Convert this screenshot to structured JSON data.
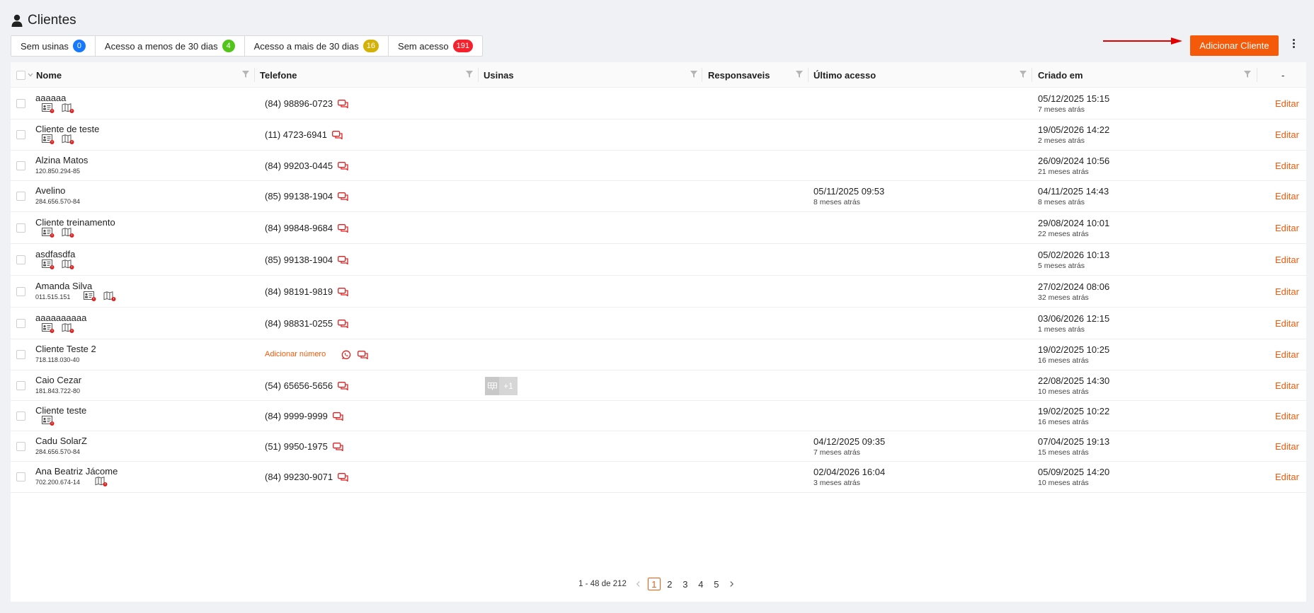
{
  "page": {
    "title": "Clientes"
  },
  "filters": [
    {
      "label": "Sem usinas",
      "count": "0",
      "color": "#1677ff"
    },
    {
      "label": "Acesso a menos de 30 dias",
      "count": "4",
      "color": "#52c41a"
    },
    {
      "label": "Acesso a mais de 30 dias",
      "count": "16",
      "color": "#d4b106"
    },
    {
      "label": "Sem acesso",
      "count": "191",
      "color": "#f5222d"
    }
  ],
  "toolbar": {
    "add_label": "Adicionar Cliente"
  },
  "table": {
    "headers": {
      "name": "Nome",
      "phone": "Telefone",
      "usinas": "Usinas",
      "responsaveis": "Responsaveis",
      "last_access": "Último acesso",
      "created": "Criado em",
      "actions": "-"
    },
    "edit_label": "Editar",
    "rows": [
      {
        "name": "aaaaaa",
        "doc": "",
        "icons": [
          "id",
          "map"
        ],
        "phone": "(84) 98896-0723",
        "last_access": "",
        "last_access_ago": "",
        "created": "05/12/2025 15:15",
        "created_ago": "7 meses atrás"
      },
      {
        "name": "Cliente de teste",
        "doc": "",
        "icons": [
          "id",
          "map"
        ],
        "phone": "(11) 4723-6941",
        "last_access": "",
        "last_access_ago": "",
        "created": "19/05/2026 14:22",
        "created_ago": "2 meses atrás"
      },
      {
        "name": "Alzina Matos",
        "doc": "120.850.294-85",
        "icons": [],
        "phone": "(84) 99203-0445",
        "last_access": "",
        "last_access_ago": "",
        "created": "26/09/2024 10:56",
        "created_ago": "21 meses atrás"
      },
      {
        "name": "Avelino",
        "doc": "284.656.570-84",
        "icons": [],
        "phone": "(85) 99138-1904",
        "last_access": "05/11/2025 09:53",
        "last_access_ago": "8 meses atrás",
        "created": "04/11/2025 14:43",
        "created_ago": "8 meses atrás"
      },
      {
        "name": "Cliente treinamento",
        "doc": "",
        "icons": [
          "id",
          "map"
        ],
        "phone": "(84) 99848-9684",
        "last_access": "",
        "last_access_ago": "",
        "created": "29/08/2024 10:01",
        "created_ago": "22 meses atrás"
      },
      {
        "name": "asdfasdfa",
        "doc": "",
        "icons": [
          "id",
          "map"
        ],
        "phone": "(85) 99138-1904",
        "last_access": "",
        "last_access_ago": "",
        "created": "05/02/2026 10:13",
        "created_ago": "5 meses atrás"
      },
      {
        "name": "Amanda Silva",
        "doc": "011.515.151",
        "icons": [
          "id",
          "map"
        ],
        "phone": "(84) 98191-9819",
        "last_access": "",
        "last_access_ago": "",
        "created": "27/02/2024 08:06",
        "created_ago": "32 meses atrás"
      },
      {
        "name": "aaaaaaaaaa",
        "doc": "",
        "icons": [
          "id",
          "map"
        ],
        "phone": "(84) 98831-0255",
        "last_access": "",
        "last_access_ago": "",
        "created": "03/06/2026 12:15",
        "created_ago": "1 meses atrás"
      },
      {
        "name": "Cliente Teste 2",
        "doc": "718.118.030-40",
        "icons": [],
        "phone": "",
        "add_number": "Adicionar número",
        "last_access": "",
        "last_access_ago": "",
        "created": "19/02/2025 10:25",
        "created_ago": "16 meses atrás"
      },
      {
        "name": "Caio Cezar",
        "doc": "181.843.722-80",
        "icons": [],
        "phone": "(54) 65656-5656",
        "usina_more": "+1",
        "last_access": "",
        "last_access_ago": "",
        "created": "22/08/2025 14:30",
        "created_ago": "10 meses atrás"
      },
      {
        "name": "Cliente teste",
        "doc": "",
        "icons": [
          "id"
        ],
        "phone": "(84) 9999-9999",
        "last_access": "",
        "last_access_ago": "",
        "created": "19/02/2025 10:22",
        "created_ago": "16 meses atrás"
      },
      {
        "name": "Cadu SolarZ",
        "doc": "284.656.570-84",
        "icons": [],
        "phone": "(51) 9950-1975",
        "last_access": "04/12/2025 09:35",
        "last_access_ago": "7 meses atrás",
        "created": "07/04/2025 19:13",
        "created_ago": "15 meses atrás"
      },
      {
        "name": "Ana Beatriz Jácome",
        "doc": "702.200.674-14",
        "icons": [
          "map"
        ],
        "phone": "(84) 99230-9071",
        "last_access": "02/04/2026 16:04",
        "last_access_ago": "3 meses atrás",
        "created": "05/09/2025 14:20",
        "created_ago": "10 meses atrás"
      }
    ]
  },
  "pagination": {
    "range": "1 - 48 de 212",
    "pages": [
      "1",
      "2",
      "3",
      "4",
      "5"
    ],
    "current": "1"
  },
  "colors": {
    "accent": "#f55a0a",
    "danger": "#e02020",
    "arrow": "#e00000"
  }
}
